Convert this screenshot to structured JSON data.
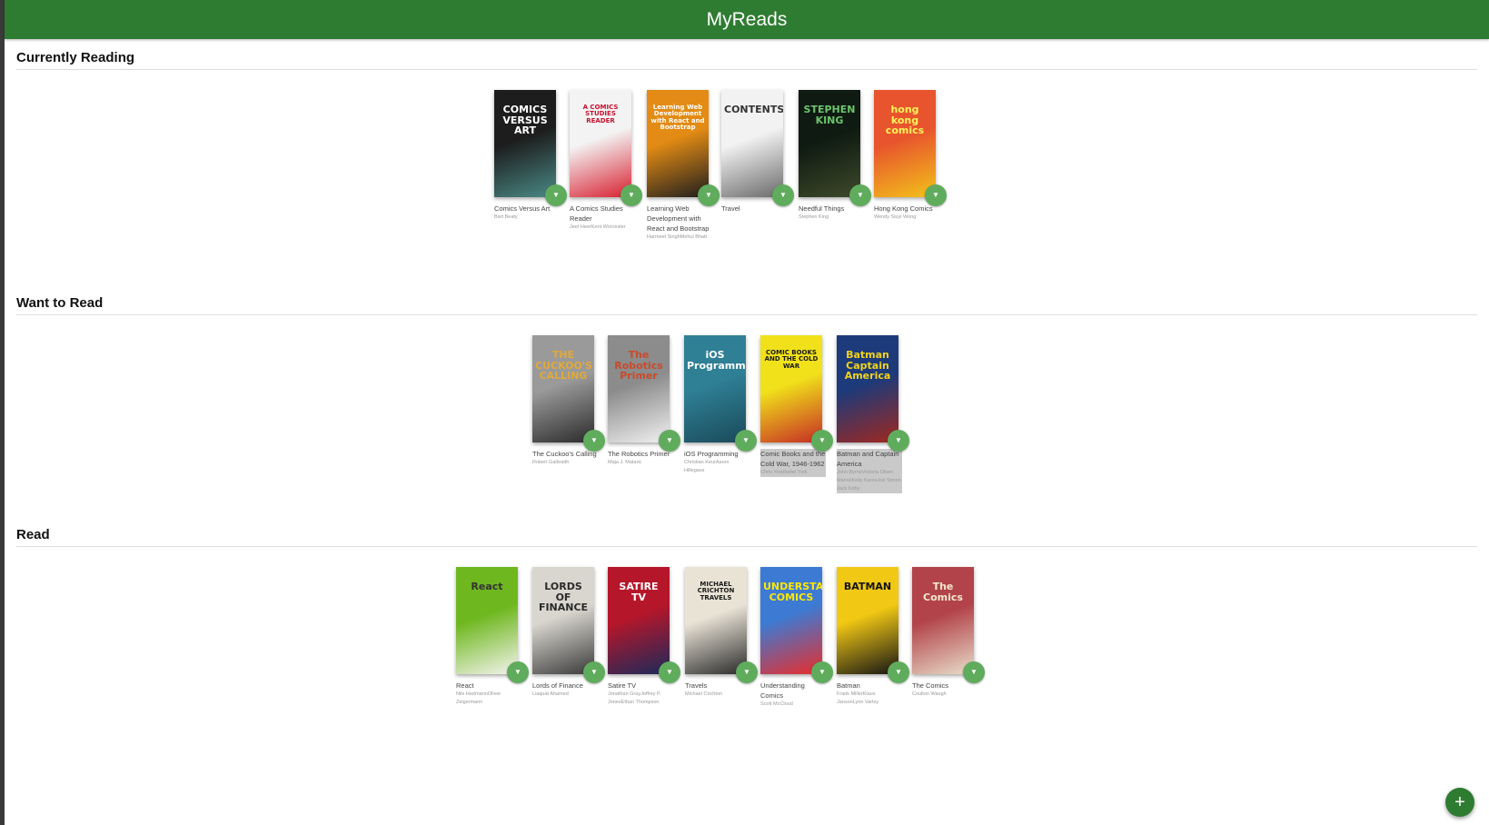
{
  "app": {
    "title": "MyReads"
  },
  "shelves": [
    {
      "title": "Currently Reading",
      "books": [
        {
          "title": "Comics Versus Art",
          "authors": "Bart Beaty",
          "cover_colors": [
            "#1d1d1d",
            "#4a8a86"
          ],
          "cover_text": "COMICS VERSUS ART",
          "cover_text_color": "#ffffff"
        },
        {
          "title": "A Comics Studies Reader",
          "authors": "Jeet HeerKent Worcester",
          "cover_colors": [
            "#f3f3f3",
            "#d81f30"
          ],
          "cover_text": "A COMICS STUDIES READER",
          "cover_text_color": "#c8102e"
        },
        {
          "title": "Learning Web Development with React and Bootstrap",
          "authors": "Harmeet SinghMehul Bhatt",
          "cover_colors": [
            "#e38b14",
            "#1e1e1e"
          ],
          "cover_text": "Learning Web Development with React and Bootstrap",
          "cover_text_color": "#ffffff"
        },
        {
          "title": "Travel",
          "authors": "",
          "cover_colors": [
            "#f2f2f2",
            "#6a6a6a"
          ],
          "cover_text": "CONTENTS",
          "cover_text_color": "#333333"
        },
        {
          "title": "Needful Things",
          "authors": "Stephen King",
          "cover_colors": [
            "#0f1a12",
            "#3e4a2a"
          ],
          "cover_text": "STEPHEN KING",
          "cover_text_color": "#6cc46c"
        },
        {
          "title": "Hong Kong Comics",
          "authors": "Wendy Siuyi Wong",
          "cover_colors": [
            "#e8542d",
            "#f2c21a"
          ],
          "cover_text": "hong kong comics",
          "cover_text_color": "#fff35a"
        }
      ]
    },
    {
      "title": "Want to Read",
      "books": [
        {
          "title": "The Cuckoo's Calling",
          "authors": "Robert Galbraith",
          "cover_colors": [
            "#9a9a9a",
            "#2b2b2b"
          ],
          "cover_text": "THE CUCKOO'S CALLING",
          "cover_text_color": "#e0a93a"
        },
        {
          "title": "The Robotics Primer",
          "authors": "Maja J. Mataric",
          "cover_colors": [
            "#8c8c8c",
            "#f1f1f1"
          ],
          "cover_text": "The Robotics Primer",
          "cover_text_color": "#c94a2a"
        },
        {
          "title": "iOS Programming",
          "authors": "Christian KeurAaron Hillegass",
          "cover_colors": [
            "#2f7f95",
            "#1a4a5a"
          ],
          "cover_text": "iOS Programming",
          "cover_text_color": "#ffffff"
        },
        {
          "title": "Comic Books and the Cold War, 1946-1962",
          "authors": "Chris YorkRafiel York",
          "cover_colors": [
            "#f0e11a",
            "#c62c25"
          ],
          "cover_text": "COMIC BOOKS AND THE COLD WAR",
          "cover_text_color": "#1a1a1a",
          "selected": true
        },
        {
          "title": "Batman and Captain America",
          "authors": "John ByrneVictoria Olsen MarvelKelly KareeJoe Simon Jack Kirby",
          "cover_colors": [
            "#1d3a7a",
            "#a0281f"
          ],
          "cover_text": "Batman Captain America",
          "cover_text_color": "#f2d41a",
          "selected": true
        }
      ]
    },
    {
      "title": "Read",
      "books": [
        {
          "title": "React",
          "authors": "Nils HartmannOliver Zeigermann",
          "cover_colors": [
            "#6fb71f",
            "#f4f4ee"
          ],
          "cover_text": "React",
          "cover_text_color": "#333333"
        },
        {
          "title": "Lords of Finance",
          "authors": "Liaquat Ahamed",
          "cover_colors": [
            "#d9d6cf",
            "#3a3a3a"
          ],
          "cover_text": "LORDS OF FINANCE",
          "cover_text_color": "#2a2a2a"
        },
        {
          "title": "Satire TV",
          "authors": "Jonathan GrayJeffrey P. JonesEthan Thompson",
          "cover_colors": [
            "#b6162a",
            "#1b2a5a"
          ],
          "cover_text": "SATIRE TV",
          "cover_text_color": "#ffffff"
        },
        {
          "title": "Travels",
          "authors": "Michael Crichton",
          "cover_colors": [
            "#e9e3d6",
            "#2a2a2a"
          ],
          "cover_text": "MICHAEL CRICHTON TRAVELS",
          "cover_text_color": "#1a1a1a"
        },
        {
          "title": "Understanding Comics",
          "authors": "Scott McCloud",
          "cover_colors": [
            "#3d7ad3",
            "#e92d2a"
          ],
          "cover_text": "UNDERSTANDING COMICS",
          "cover_text_color": "#ffe800"
        },
        {
          "title": "Batman",
          "authors": "Frank MillerKlaus JansonLynn Varley",
          "cover_colors": [
            "#f1c814",
            "#141414"
          ],
          "cover_text": "BATMAN",
          "cover_text_color": "#141414"
        },
        {
          "title": "The Comics",
          "authors": "Coulton Waugh",
          "cover_colors": [
            "#b2434a",
            "#e8ddc9"
          ],
          "cover_text": "The Comics",
          "cover_text_color": "#f4e8d0"
        }
      ]
    }
  ],
  "shelf_changer_icon": "chevron-down-icon",
  "add_button": {
    "label": "+",
    "icon": "plus-icon"
  },
  "colors": {
    "header": "#2e7c31",
    "shelf_changer": "#60ac5d",
    "add_button": "#2e7c31"
  }
}
